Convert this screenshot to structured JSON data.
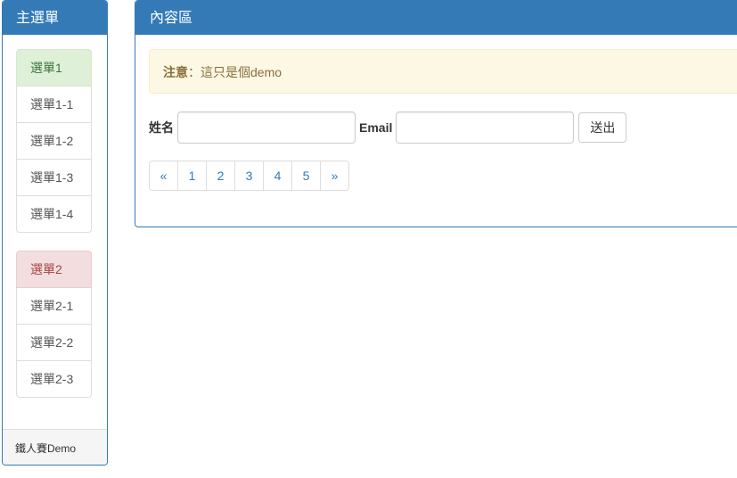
{
  "sidebar": {
    "title": "主選單",
    "groups": [
      {
        "header": "選單1",
        "items": [
          "選單1-1",
          "選單1-2",
          "選單1-3",
          "選單1-4"
        ]
      },
      {
        "header": "選單2",
        "items": [
          "選單2-1",
          "選單2-2",
          "選單2-3"
        ]
      }
    ],
    "footer": "鐵人賽Demo"
  },
  "content": {
    "title": "內容區",
    "alert": {
      "strong": "注意",
      "text": "：這只是個demo"
    },
    "form": {
      "name_label": "姓名",
      "name_value": "",
      "email_label": "Email",
      "email_value": "",
      "submit_label": "送出"
    },
    "pagination": [
      "«",
      "1",
      "2",
      "3",
      "4",
      "5",
      "»"
    ]
  },
  "colors": {
    "primary": "#337ab7",
    "success_bg": "#dff0d8",
    "danger_bg": "#f2dede",
    "warning_bg": "#fcf8e3"
  }
}
